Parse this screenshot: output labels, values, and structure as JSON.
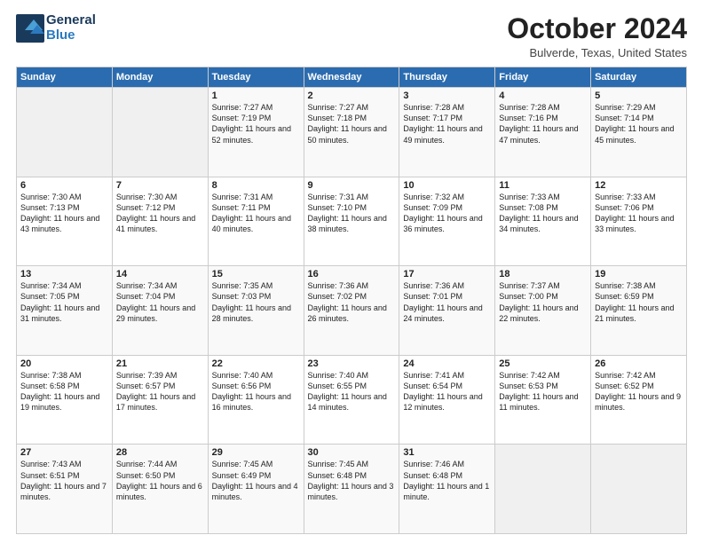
{
  "logo": {
    "general": "General",
    "blue": "Blue"
  },
  "header": {
    "month": "October 2024",
    "location": "Bulverde, Texas, United States"
  },
  "days_of_week": [
    "Sunday",
    "Monday",
    "Tuesday",
    "Wednesday",
    "Thursday",
    "Friday",
    "Saturday"
  ],
  "weeks": [
    [
      {
        "day": "",
        "empty": true
      },
      {
        "day": "",
        "empty": true
      },
      {
        "day": "1",
        "sunrise": "7:27 AM",
        "sunset": "7:19 PM",
        "daylight": "11 hours and 52 minutes."
      },
      {
        "day": "2",
        "sunrise": "7:27 AM",
        "sunset": "7:18 PM",
        "daylight": "11 hours and 50 minutes."
      },
      {
        "day": "3",
        "sunrise": "7:28 AM",
        "sunset": "7:17 PM",
        "daylight": "11 hours and 49 minutes."
      },
      {
        "day": "4",
        "sunrise": "7:28 AM",
        "sunset": "7:16 PM",
        "daylight": "11 hours and 47 minutes."
      },
      {
        "day": "5",
        "sunrise": "7:29 AM",
        "sunset": "7:14 PM",
        "daylight": "11 hours and 45 minutes."
      }
    ],
    [
      {
        "day": "6",
        "sunrise": "7:30 AM",
        "sunset": "7:13 PM",
        "daylight": "11 hours and 43 minutes."
      },
      {
        "day": "7",
        "sunrise": "7:30 AM",
        "sunset": "7:12 PM",
        "daylight": "11 hours and 41 minutes."
      },
      {
        "day": "8",
        "sunrise": "7:31 AM",
        "sunset": "7:11 PM",
        "daylight": "11 hours and 40 minutes."
      },
      {
        "day": "9",
        "sunrise": "7:31 AM",
        "sunset": "7:10 PM",
        "daylight": "11 hours and 38 minutes."
      },
      {
        "day": "10",
        "sunrise": "7:32 AM",
        "sunset": "7:09 PM",
        "daylight": "11 hours and 36 minutes."
      },
      {
        "day": "11",
        "sunrise": "7:33 AM",
        "sunset": "7:08 PM",
        "daylight": "11 hours and 34 minutes."
      },
      {
        "day": "12",
        "sunrise": "7:33 AM",
        "sunset": "7:06 PM",
        "daylight": "11 hours and 33 minutes."
      }
    ],
    [
      {
        "day": "13",
        "sunrise": "7:34 AM",
        "sunset": "7:05 PM",
        "daylight": "11 hours and 31 minutes."
      },
      {
        "day": "14",
        "sunrise": "7:34 AM",
        "sunset": "7:04 PM",
        "daylight": "11 hours and 29 minutes."
      },
      {
        "day": "15",
        "sunrise": "7:35 AM",
        "sunset": "7:03 PM",
        "daylight": "11 hours and 28 minutes."
      },
      {
        "day": "16",
        "sunrise": "7:36 AM",
        "sunset": "7:02 PM",
        "daylight": "11 hours and 26 minutes."
      },
      {
        "day": "17",
        "sunrise": "7:36 AM",
        "sunset": "7:01 PM",
        "daylight": "11 hours and 24 minutes."
      },
      {
        "day": "18",
        "sunrise": "7:37 AM",
        "sunset": "7:00 PM",
        "daylight": "11 hours and 22 minutes."
      },
      {
        "day": "19",
        "sunrise": "7:38 AM",
        "sunset": "6:59 PM",
        "daylight": "11 hours and 21 minutes."
      }
    ],
    [
      {
        "day": "20",
        "sunrise": "7:38 AM",
        "sunset": "6:58 PM",
        "daylight": "11 hours and 19 minutes."
      },
      {
        "day": "21",
        "sunrise": "7:39 AM",
        "sunset": "6:57 PM",
        "daylight": "11 hours and 17 minutes."
      },
      {
        "day": "22",
        "sunrise": "7:40 AM",
        "sunset": "6:56 PM",
        "daylight": "11 hours and 16 minutes."
      },
      {
        "day": "23",
        "sunrise": "7:40 AM",
        "sunset": "6:55 PM",
        "daylight": "11 hours and 14 minutes."
      },
      {
        "day": "24",
        "sunrise": "7:41 AM",
        "sunset": "6:54 PM",
        "daylight": "11 hours and 12 minutes."
      },
      {
        "day": "25",
        "sunrise": "7:42 AM",
        "sunset": "6:53 PM",
        "daylight": "11 hours and 11 minutes."
      },
      {
        "day": "26",
        "sunrise": "7:42 AM",
        "sunset": "6:52 PM",
        "daylight": "11 hours and 9 minutes."
      }
    ],
    [
      {
        "day": "27",
        "sunrise": "7:43 AM",
        "sunset": "6:51 PM",
        "daylight": "11 hours and 7 minutes."
      },
      {
        "day": "28",
        "sunrise": "7:44 AM",
        "sunset": "6:50 PM",
        "daylight": "11 hours and 6 minutes."
      },
      {
        "day": "29",
        "sunrise": "7:45 AM",
        "sunset": "6:49 PM",
        "daylight": "11 hours and 4 minutes."
      },
      {
        "day": "30",
        "sunrise": "7:45 AM",
        "sunset": "6:48 PM",
        "daylight": "11 hours and 3 minutes."
      },
      {
        "day": "31",
        "sunrise": "7:46 AM",
        "sunset": "6:48 PM",
        "daylight": "11 hours and 1 minute."
      },
      {
        "day": "",
        "empty": true
      },
      {
        "day": "",
        "empty": true
      }
    ]
  ]
}
